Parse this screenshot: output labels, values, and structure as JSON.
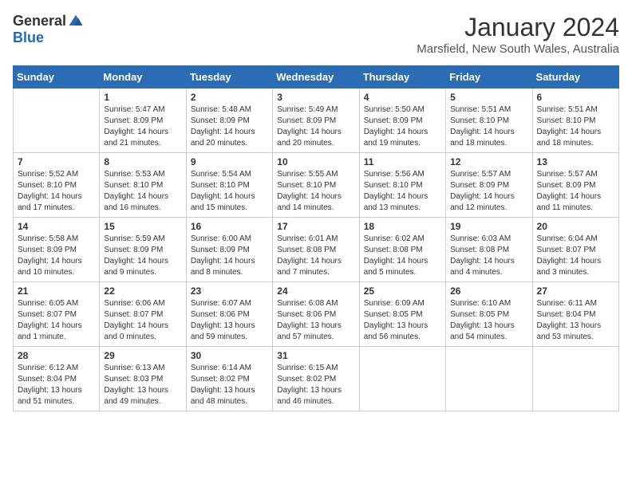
{
  "header": {
    "logo_general": "General",
    "logo_blue": "Blue",
    "title": "January 2024",
    "location": "Marsfield, New South Wales, Australia"
  },
  "days_of_week": [
    "Sunday",
    "Monday",
    "Tuesday",
    "Wednesday",
    "Thursday",
    "Friday",
    "Saturday"
  ],
  "weeks": [
    [
      {
        "day": "",
        "info": ""
      },
      {
        "day": "1",
        "info": "Sunrise: 5:47 AM\nSunset: 8:09 PM\nDaylight: 14 hours\nand 21 minutes."
      },
      {
        "day": "2",
        "info": "Sunrise: 5:48 AM\nSunset: 8:09 PM\nDaylight: 14 hours\nand 20 minutes."
      },
      {
        "day": "3",
        "info": "Sunrise: 5:49 AM\nSunset: 8:09 PM\nDaylight: 14 hours\nand 20 minutes."
      },
      {
        "day": "4",
        "info": "Sunrise: 5:50 AM\nSunset: 8:09 PM\nDaylight: 14 hours\nand 19 minutes."
      },
      {
        "day": "5",
        "info": "Sunrise: 5:51 AM\nSunset: 8:10 PM\nDaylight: 14 hours\nand 18 minutes."
      },
      {
        "day": "6",
        "info": "Sunrise: 5:51 AM\nSunset: 8:10 PM\nDaylight: 14 hours\nand 18 minutes."
      }
    ],
    [
      {
        "day": "7",
        "info": "Sunrise: 5:52 AM\nSunset: 8:10 PM\nDaylight: 14 hours\nand 17 minutes."
      },
      {
        "day": "8",
        "info": "Sunrise: 5:53 AM\nSunset: 8:10 PM\nDaylight: 14 hours\nand 16 minutes."
      },
      {
        "day": "9",
        "info": "Sunrise: 5:54 AM\nSunset: 8:10 PM\nDaylight: 14 hours\nand 15 minutes."
      },
      {
        "day": "10",
        "info": "Sunrise: 5:55 AM\nSunset: 8:10 PM\nDaylight: 14 hours\nand 14 minutes."
      },
      {
        "day": "11",
        "info": "Sunrise: 5:56 AM\nSunset: 8:10 PM\nDaylight: 14 hours\nand 13 minutes."
      },
      {
        "day": "12",
        "info": "Sunrise: 5:57 AM\nSunset: 8:09 PM\nDaylight: 14 hours\nand 12 minutes."
      },
      {
        "day": "13",
        "info": "Sunrise: 5:57 AM\nSunset: 8:09 PM\nDaylight: 14 hours\nand 11 minutes."
      }
    ],
    [
      {
        "day": "14",
        "info": "Sunrise: 5:58 AM\nSunset: 8:09 PM\nDaylight: 14 hours\nand 10 minutes."
      },
      {
        "day": "15",
        "info": "Sunrise: 5:59 AM\nSunset: 8:09 PM\nDaylight: 14 hours\nand 9 minutes."
      },
      {
        "day": "16",
        "info": "Sunrise: 6:00 AM\nSunset: 8:09 PM\nDaylight: 14 hours\nand 8 minutes."
      },
      {
        "day": "17",
        "info": "Sunrise: 6:01 AM\nSunset: 8:08 PM\nDaylight: 14 hours\nand 7 minutes."
      },
      {
        "day": "18",
        "info": "Sunrise: 6:02 AM\nSunset: 8:08 PM\nDaylight: 14 hours\nand 5 minutes."
      },
      {
        "day": "19",
        "info": "Sunrise: 6:03 AM\nSunset: 8:08 PM\nDaylight: 14 hours\nand 4 minutes."
      },
      {
        "day": "20",
        "info": "Sunrise: 6:04 AM\nSunset: 8:07 PM\nDaylight: 14 hours\nand 3 minutes."
      }
    ],
    [
      {
        "day": "21",
        "info": "Sunrise: 6:05 AM\nSunset: 8:07 PM\nDaylight: 14 hours\nand 1 minute."
      },
      {
        "day": "22",
        "info": "Sunrise: 6:06 AM\nSunset: 8:07 PM\nDaylight: 14 hours\nand 0 minutes."
      },
      {
        "day": "23",
        "info": "Sunrise: 6:07 AM\nSunset: 8:06 PM\nDaylight: 13 hours\nand 59 minutes."
      },
      {
        "day": "24",
        "info": "Sunrise: 6:08 AM\nSunset: 8:06 PM\nDaylight: 13 hours\nand 57 minutes."
      },
      {
        "day": "25",
        "info": "Sunrise: 6:09 AM\nSunset: 8:05 PM\nDaylight: 13 hours\nand 56 minutes."
      },
      {
        "day": "26",
        "info": "Sunrise: 6:10 AM\nSunset: 8:05 PM\nDaylight: 13 hours\nand 54 minutes."
      },
      {
        "day": "27",
        "info": "Sunrise: 6:11 AM\nSunset: 8:04 PM\nDaylight: 13 hours\nand 53 minutes."
      }
    ],
    [
      {
        "day": "28",
        "info": "Sunrise: 6:12 AM\nSunset: 8:04 PM\nDaylight: 13 hours\nand 51 minutes."
      },
      {
        "day": "29",
        "info": "Sunrise: 6:13 AM\nSunset: 8:03 PM\nDaylight: 13 hours\nand 49 minutes."
      },
      {
        "day": "30",
        "info": "Sunrise: 6:14 AM\nSunset: 8:02 PM\nDaylight: 13 hours\nand 48 minutes."
      },
      {
        "day": "31",
        "info": "Sunrise: 6:15 AM\nSunset: 8:02 PM\nDaylight: 13 hours\nand 46 minutes."
      },
      {
        "day": "",
        "info": ""
      },
      {
        "day": "",
        "info": ""
      },
      {
        "day": "",
        "info": ""
      }
    ]
  ]
}
